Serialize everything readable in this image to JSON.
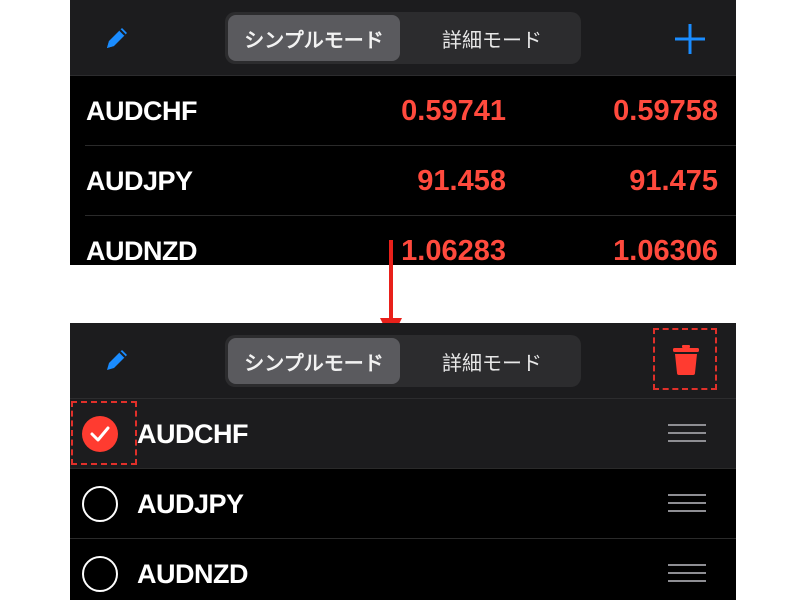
{
  "colors": {
    "accent": "#1a8cff",
    "price": "#ff4a3d",
    "destructive": "#ff3b30",
    "annotation": "#e0302a"
  },
  "top_panel": {
    "header": {
      "left_icon": "pencil-icon",
      "segments": [
        "シンプルモード",
        "詳細モード"
      ],
      "selected_segment": "シンプルモード",
      "right_icon": "plus-icon"
    },
    "rows": [
      {
        "symbol": "AUDCHF",
        "bid": "0.59741",
        "ask": "0.59758"
      },
      {
        "symbol": "AUDJPY",
        "bid": "91.458",
        "ask": "91.475"
      },
      {
        "symbol": "AUDNZD",
        "bid": "1.06283",
        "ask": "1.06306"
      }
    ]
  },
  "bottom_panel": {
    "header": {
      "left_icon": "pencil-icon",
      "segments": [
        "シンプルモード",
        "詳細モード"
      ],
      "selected_segment": "シンプルモード",
      "right_icon": "trash-icon"
    },
    "rows": [
      {
        "symbol": "AUDCHF",
        "selected": true
      },
      {
        "symbol": "AUDJPY",
        "selected": false
      },
      {
        "symbol": "AUDNZD",
        "selected": false
      }
    ]
  }
}
